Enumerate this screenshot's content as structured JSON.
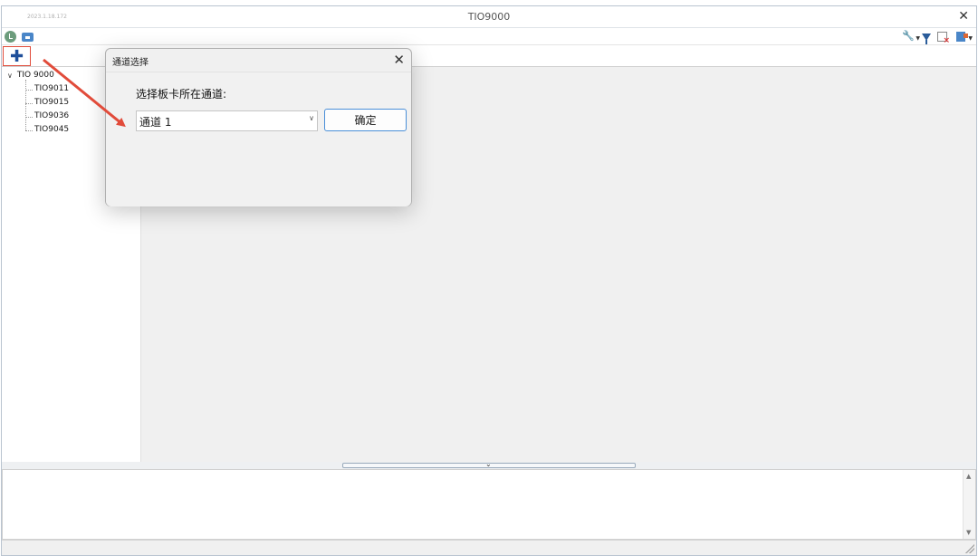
{
  "window": {
    "build_stamp": "2023.1.18.172",
    "title": "TIO9000",
    "close_glyph": "✕"
  },
  "toolbar": {
    "left_icons": [
      "clock-icon",
      "monitor-icon"
    ],
    "right_icons": [
      "wrench-icon",
      "filter-icon",
      "calendar-clear-icon",
      "export-icon"
    ]
  },
  "tabstrip": {
    "add_glyph": "✚"
  },
  "tree": {
    "root": {
      "expand_glyph": "∨",
      "label": "TIO 9000"
    },
    "children": [
      "TIO9011",
      "TIO9015",
      "TIO9036",
      "TIO9045"
    ]
  },
  "dialog": {
    "title": "通道选择",
    "close_glyph": "✕",
    "prompt": "选择板卡所在通道:",
    "select_value": "通道 1",
    "select_arrow": "∨",
    "ok_label": "确定"
  },
  "splitter": {
    "arrow": "⌄"
  },
  "log_scrollbar": {
    "up": "▲",
    "down": "▼"
  },
  "colors": {
    "annotation": "#e14b3a",
    "accent_blue": "#1f4f9a",
    "button_border": "#4a8fd8"
  }
}
